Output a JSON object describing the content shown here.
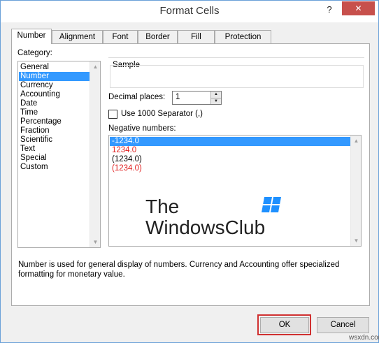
{
  "window": {
    "title": "Format Cells",
    "help_glyph": "?",
    "close_glyph": "✕"
  },
  "tabs": [
    {
      "label": "Number",
      "active": true
    },
    {
      "label": "Alignment",
      "active": false
    },
    {
      "label": "Font",
      "active": false
    },
    {
      "label": "Border",
      "active": false
    },
    {
      "label": "Fill",
      "active": false
    },
    {
      "label": "Protection",
      "active": false
    }
  ],
  "category": {
    "label": "Category:",
    "items": [
      "General",
      "Number",
      "Currency",
      "Accounting",
      "Date",
      "Time",
      "Percentage",
      "Fraction",
      "Scientific",
      "Text",
      "Special",
      "Custom"
    ],
    "selected": "Number"
  },
  "sample": {
    "label": "Sample",
    "value": ""
  },
  "decimal_places": {
    "label": "Decimal places:",
    "value": "1"
  },
  "separator": {
    "label": "Use 1000 Separator (,)",
    "checked": false
  },
  "negative_numbers": {
    "label": "Negative numbers:",
    "items": [
      {
        "text": "-1234.0",
        "color": "#000000",
        "selected": true
      },
      {
        "text": "1234.0",
        "color": "#e02020",
        "selected": false
      },
      {
        "text": "(1234.0)",
        "color": "#000000",
        "selected": false
      },
      {
        "text": "(1234.0)",
        "color": "#e02020",
        "selected": false
      }
    ]
  },
  "watermark": {
    "line1": "The",
    "line2": "WindowsClub",
    "logo_color": "#1e90ff"
  },
  "description": {
    "line1": "Number is used for general display of numbers.  Currency and Accounting offer specialized",
    "line2": "formatting for monetary value."
  },
  "buttons": {
    "ok": "OK",
    "cancel": "Cancel"
  },
  "site_mark": "wsxdn.com",
  "colors": {
    "selection": "#3399ff",
    "negative_red": "#e02020",
    "highlight": "#d03030"
  }
}
